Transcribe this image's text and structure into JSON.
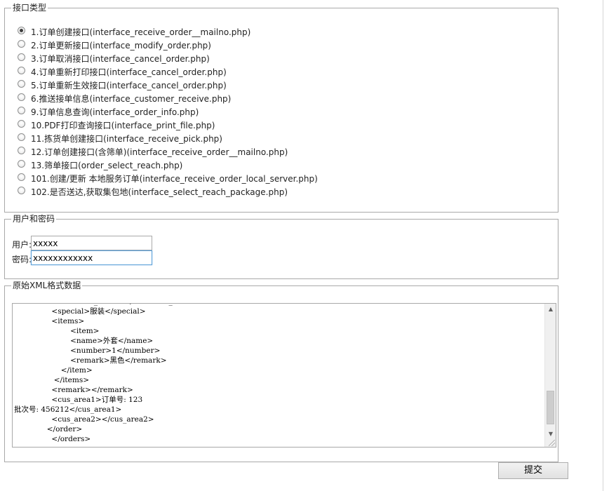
{
  "api_section": {
    "legend": "接口类型",
    "options": [
      {
        "label": "1.订单创建接口(interface_receive_order__mailno.php)",
        "checked": true
      },
      {
        "label": "2.订单更新接口(interface_modify_order.php)",
        "checked": false
      },
      {
        "label": "3.订单取消接口(interface_cancel_order.php)",
        "checked": false
      },
      {
        "label": "4.订单重新打印接口(interface_cancel_order.php)",
        "checked": false
      },
      {
        "label": "5.订单重新生效接口(interface_cancel_order.php)",
        "checked": false
      },
      {
        "label": "6.推送接单信息(interface_customer_receive.php)",
        "checked": false
      },
      {
        "label": "9.订单信息查询(interface_order_info.php)",
        "checked": false
      },
      {
        "label": "10.PDF打印查询接口(interface_print_file.php)",
        "checked": false
      },
      {
        "label": "11.拣货单创建接口(interface_receive_pick.php)",
        "checked": false
      },
      {
        "label": "12.订单创建接口(含筛单)(interface_receive_order__mailno.php)",
        "checked": false
      },
      {
        "label": "13.筛单接口(order_select_reach.php)",
        "checked": false
      },
      {
        "label": "101.创建/更新 本地服务订单(interface_receive_order_local_server.php)",
        "checked": false
      },
      {
        "label": "102.是否送达,获取集包地(interface_select_reach_package.php)",
        "checked": false
      }
    ]
  },
  "credentials": {
    "legend": "用户和密码",
    "user_label": "用户:",
    "user_value": "xxxxx",
    "password_label": "密码:",
    "password_value": "xxxxxxxxxxxx"
  },
  "xml_section": {
    "legend": "原始XML格式数据",
    "content": "                <collection_value></collection_value>\n                <special>服装</special>\n                <items>\n                        <item>\n                        <name>外套</name>\n                        <number>1</number>\n                        <remark>黑色</remark>\n                    </item>\n                 </items>\n                <remark></remark>\n                <cus_area1>订单号: 123\n批次号: 456212</cus_area1>\n                <cus_area2></cus_area2>\n              </order>\n                </orders>"
  },
  "submit_label": "提交"
}
